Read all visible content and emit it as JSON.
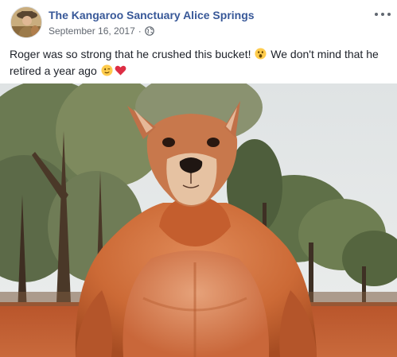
{
  "post": {
    "page_name": "The Kangaroo Sanctuary Alice Springs",
    "date": "September 16, 2017",
    "separator": "·",
    "privacy_icon": "globe-icon",
    "more_icon": "more-options-icon",
    "text_part1": "Roger was so strong that he crushed this bucket! ",
    "text_part2": " We don't mind that he retired a year ago ",
    "emojis": [
      "astonished-face-emoji",
      "winking-face-emoji",
      "red-heart-emoji"
    ],
    "photo_subject": "kangaroo-photo"
  },
  "colors": {
    "link": "#385898",
    "meta": "#616770",
    "text": "#1d2129"
  }
}
